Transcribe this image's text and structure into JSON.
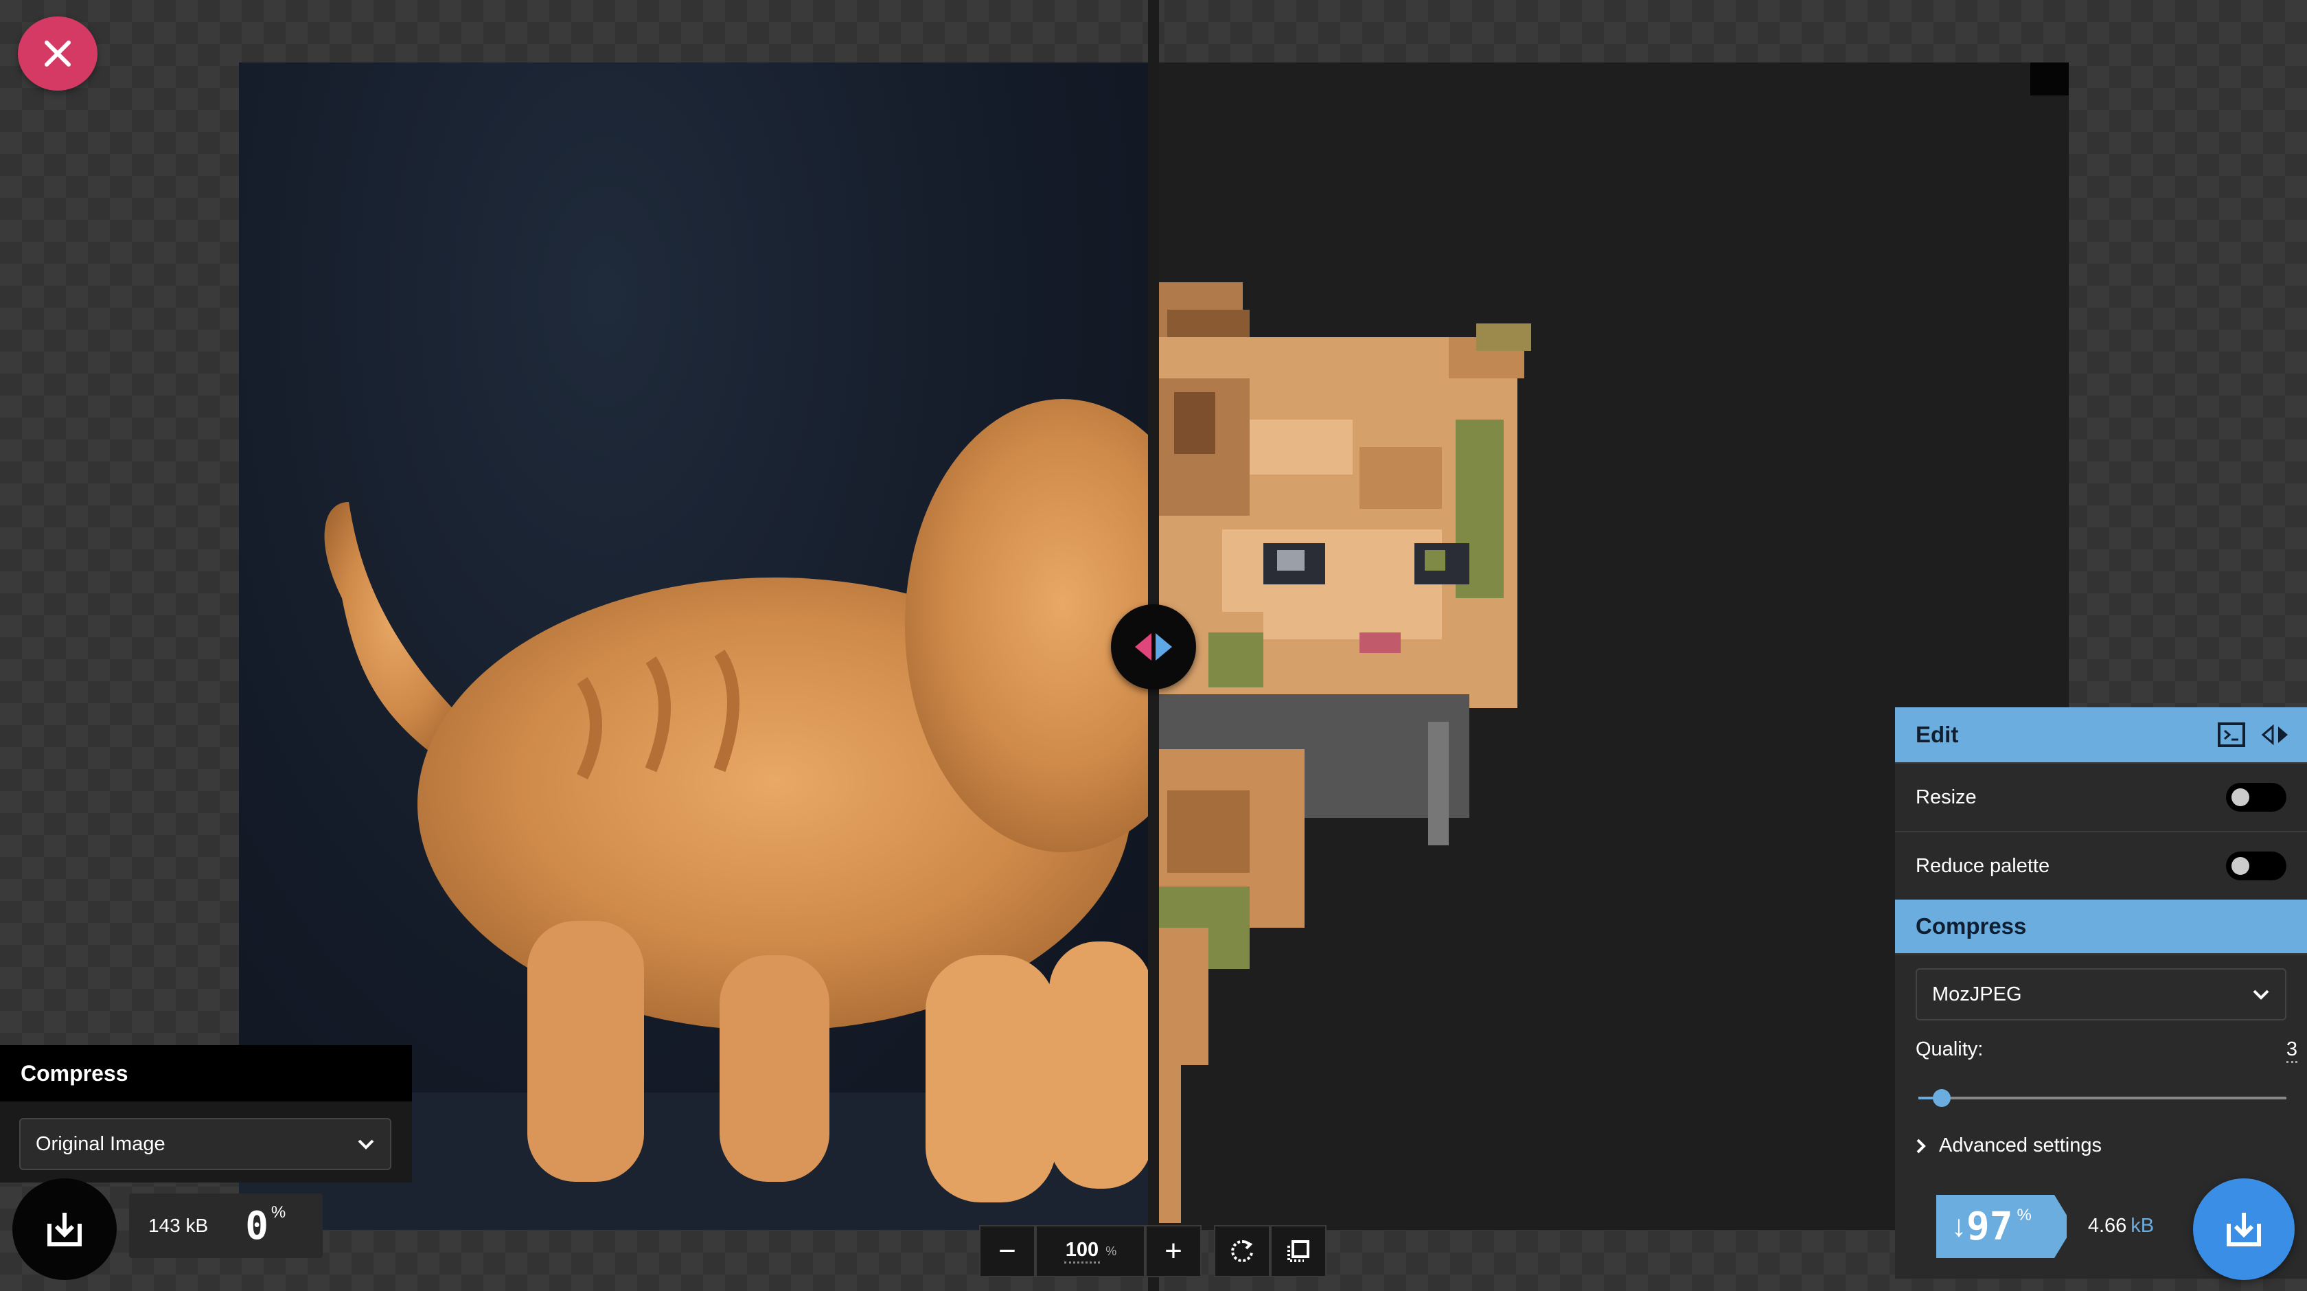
{
  "close": {
    "icon": "close-icon"
  },
  "left_panel": {
    "title": "Compress",
    "select_value": "Original Image"
  },
  "left_result": {
    "size_value": "143",
    "size_unit": "kB",
    "percent_value": "0",
    "percent_sign": "%"
  },
  "zoom": {
    "minus": "−",
    "value": "100",
    "unit": "%",
    "plus": "+"
  },
  "right_panel": {
    "edit_title": "Edit",
    "resize_label": "Resize",
    "reduce_palette_label": "Reduce palette",
    "compress_title": "Compress",
    "codec_value": "MozJPEG",
    "quality_label": "Quality:",
    "quality_value": "3",
    "advanced_label": "Advanced settings",
    "resize_on": false,
    "reduce_palette_on": false
  },
  "right_result": {
    "arrow": "↓",
    "saving_value": "97",
    "saving_sign": "%",
    "size_value": "4.66",
    "size_unit": "kB"
  },
  "colors": {
    "accent_blue": "#6badde",
    "download_blue": "#3a8ee6",
    "close_red": "#d43a64",
    "handle_left": "#e0457b",
    "handle_right": "#5fa8e8"
  }
}
